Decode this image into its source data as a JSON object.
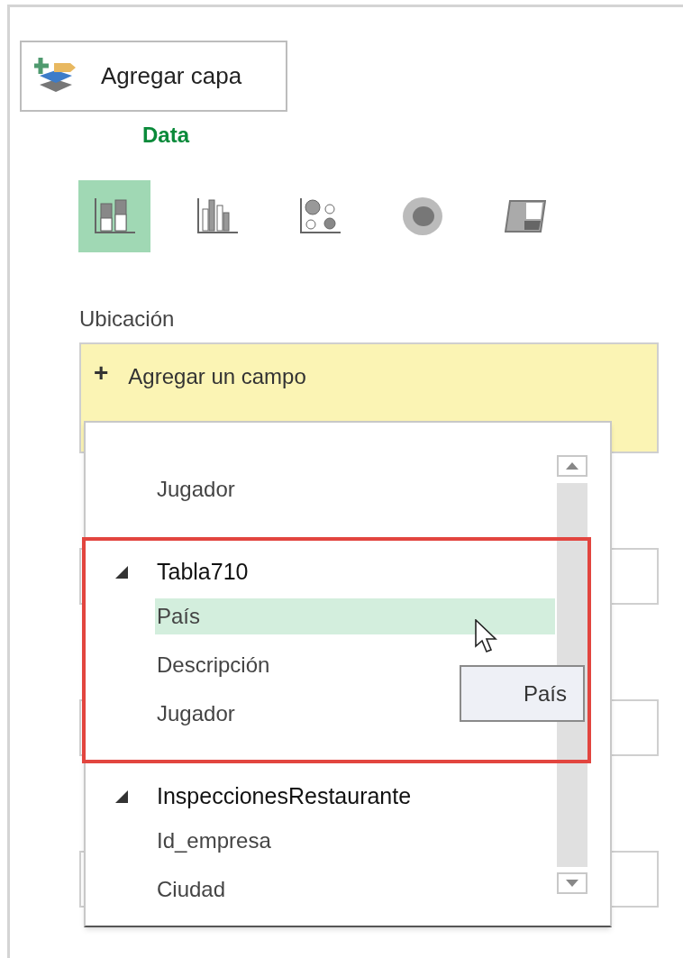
{
  "add_layer_button": {
    "label": "Agregar capa"
  },
  "section_heading": "Data",
  "chart_types": [
    {
      "kind": "stacked",
      "selected": true
    },
    {
      "kind": "clustered",
      "selected": false
    },
    {
      "kind": "bubble",
      "selected": false
    },
    {
      "kind": "heatmap",
      "selected": false
    },
    {
      "kind": "region",
      "selected": false
    }
  ],
  "location": {
    "label": "Ubicación",
    "add_field": {
      "icon": "+",
      "label": "Agregar un campo"
    }
  },
  "field_list": {
    "groups": [
      {
        "children": [
          {
            "label": "Jugador",
            "selected": false
          }
        ]
      },
      {
        "name": "Tabla710",
        "expanded": true,
        "highlighted": true,
        "children": [
          {
            "label": "País",
            "selected": true
          },
          {
            "label": "Descripción",
            "selected": false
          },
          {
            "label": "Jugador",
            "selected": false
          }
        ]
      },
      {
        "name": "InspeccionesRestaurante",
        "expanded": true,
        "highlighted": false,
        "children": [
          {
            "label": "Id_empresa",
            "selected": false
          },
          {
            "label": "Ciudad",
            "selected": false
          }
        ]
      }
    ]
  },
  "tooltip": "País"
}
